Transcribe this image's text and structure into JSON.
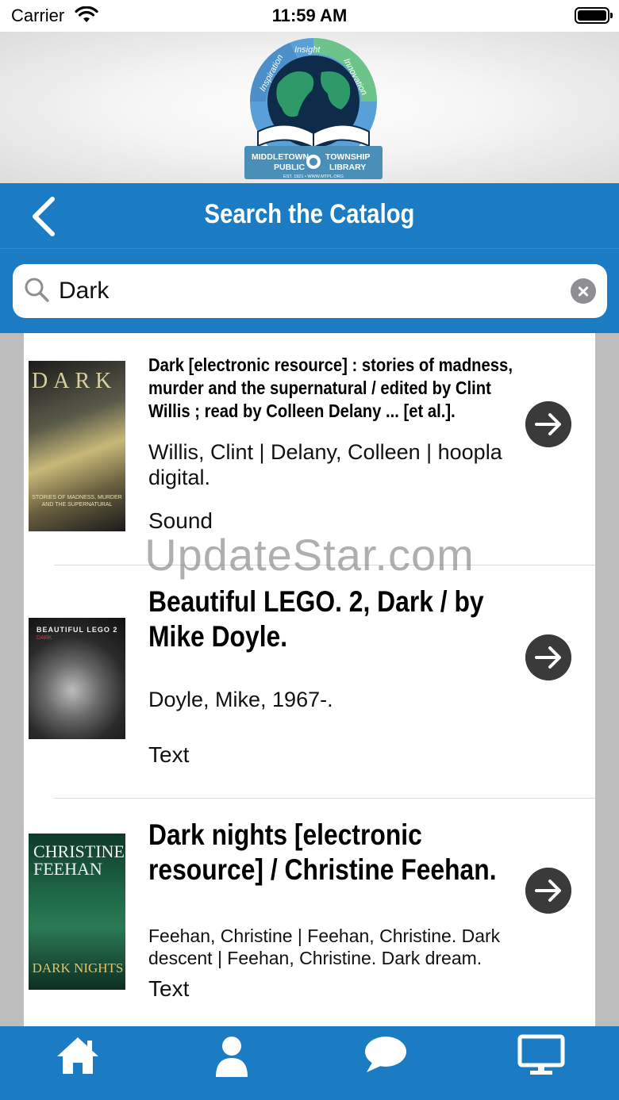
{
  "status": {
    "carrier": "Carrier",
    "time": "11:59 AM",
    "icons": [
      "wifi-icon",
      "battery-icon"
    ]
  },
  "logo": {
    "arc_words": [
      "Inspiration",
      "Insight",
      "Innovation"
    ],
    "line1_left": "MIDDLETOWN",
    "line1_right": "TOWNSHIP",
    "line2_left": "PUBLIC",
    "line2_right": "LIBRARY",
    "line3": "EST. 1921 • WWW.MTPL.ORG"
  },
  "nav": {
    "title": "Search the Catalog",
    "back_icon": "chevron-left-icon"
  },
  "search": {
    "value": "Dark",
    "icon": "search-icon",
    "clear_icon": "clear-icon"
  },
  "results": [
    {
      "title": "Dark [electronic resource] : stories of madness, murder and the supernatural / edited by Clint Willis ; read by Colleen Delany ... [et al.].",
      "authors": "Willis, Clint | Delany, Colleen | hoopla digital.",
      "format": "Sound",
      "cover_text": "DARK",
      "cover_subtitle": "STORIES OF MADNESS, MURDER AND THE SUPERNATURAL"
    },
    {
      "title": "Beautiful LEGO. 2, Dark / by Mike Doyle.",
      "authors": "Doyle, Mike, 1967-.",
      "format": "Text",
      "cover_text": "BEAUTIFUL LEGO 2",
      "cover_subtitle": "DARK"
    },
    {
      "title": "Dark nights [electronic resource] / Christine Feehan.",
      "authors": "Feehan, Christine | Feehan, Christine. Dark descent | Feehan, Christine. Dark dream.",
      "format": "Text",
      "cover_text": "CHRISTINE FEEHAN",
      "cover_subtitle": "DARK NIGHTS"
    }
  ],
  "watermark": "UpdateStar.com",
  "tabs": [
    {
      "icon": "home-icon"
    },
    {
      "icon": "account-icon"
    },
    {
      "icon": "chat-icon"
    },
    {
      "icon": "computer-icon"
    }
  ],
  "colors": {
    "brand_blue": "#1b7cc4",
    "arrow_button": "#3a3a3a"
  }
}
